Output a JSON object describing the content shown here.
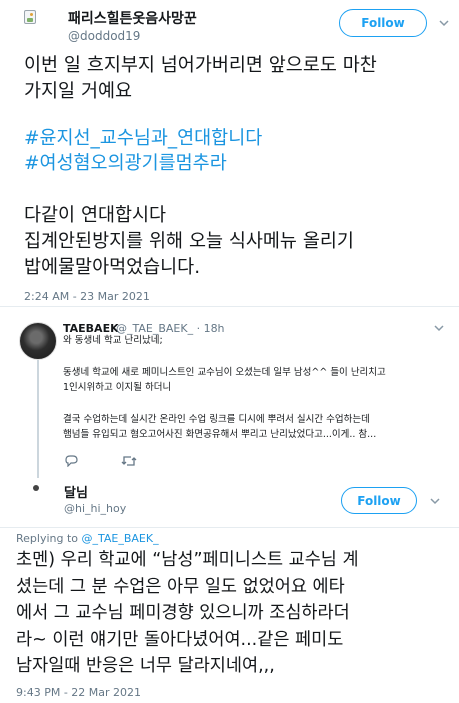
{
  "tweet": {
    "author_name": "패리스힐튼옷음사망꾼",
    "author_handle": "@doddod19",
    "follow_label": "Follow",
    "lines": [
      "이번 일 흐지부지 넘어가버리면 앞으로도 마찬",
      "가지일 거예요",
      "#윤지선_교수님과_연대합니다",
      "#여성혐오의광기를멈추라",
      "다같이 연대합시다",
      "집계안된방지를 위해 오늘 식사메뉴 올리기",
      "밥에물말아먹었습니다."
    ],
    "timestamp": "2:24 AM - 23 Mar 2021"
  },
  "quoted": {
    "author_name": "TAEBAEK",
    "author_meta": "@_TAE_BAEK_ · 18h",
    "lines": [
      "와 동생네 학교 난리났네;",
      "동생네 학교에 새로 페미니스트인 교수님이 오셨는데 일부 남성^^ 들이 난리치고",
      "1인시위하고 이지될 하더니",
      "결국 수업하는데 실시간 온라인 수업 링크를 디시에 뿌려서 실시간 수업하는데",
      "햄넘들 유입되고 혐오고어사진 화면공유해서 뿌리고 난리났었다고...이게.. 참..."
    ]
  },
  "reply": {
    "author_name": "달님",
    "author_handle": "@hi_hi_hoy",
    "follow_label": "Follow",
    "replying_prefix": "Replying to",
    "replying_handle": "@_TAE_BAEK_",
    "lines": [
      "초멘) 우리 학교에 “남성”페미니스트 교수님 계",
      "셨는데 그 분 수업은 아무 일도 없었어요 에타",
      "에서 그 교수님 페미경향 있으니까 조심하라더",
      "라~ 이런 얘기만 돌아다녔어여...같은 페미도",
      "남자일때 반응은 너무 달라지네여,,,"
    ],
    "timestamp": "9:43 PM - 22 Mar 2021"
  },
  "colors": {
    "link": "#1b95e0",
    "follow_border": "#1da1f2",
    "muted": "#657786"
  }
}
